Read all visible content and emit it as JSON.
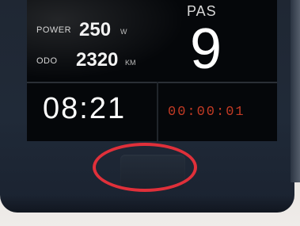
{
  "display": {
    "power": {
      "label": "POWER",
      "value": "250",
      "unit": "W"
    },
    "odo": {
      "label": "ODO",
      "value": "2320",
      "unit": "KM"
    },
    "pas": {
      "label": "PAS",
      "value": "9"
    },
    "clock": "08:21",
    "timer": "00:00:01"
  },
  "annotation": {
    "highlight_color": "#e0303a",
    "target": "power-button"
  },
  "colors": {
    "timer": "#c23a24",
    "bezel": "#1f2733"
  }
}
